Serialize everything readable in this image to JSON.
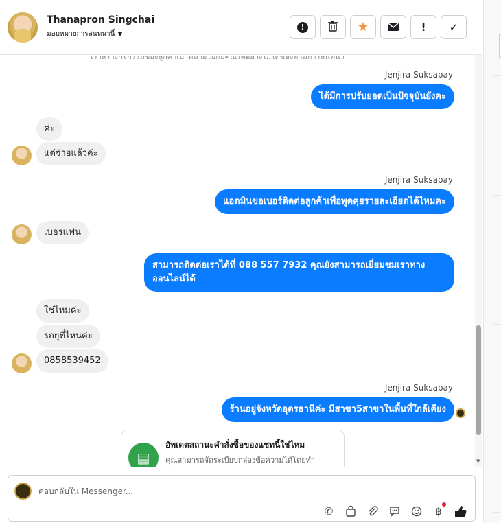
{
  "header": {
    "name": "Thanapron Singchai",
    "assign_label": "มอบหมายการสนทนานี้",
    "toolbar": [
      {
        "icon": "alert-circle-icon",
        "glyph": "❗"
      },
      {
        "icon": "trash-icon",
        "glyph": "🗑"
      },
      {
        "icon": "star-icon",
        "glyph": "★"
      },
      {
        "icon": "mail-icon",
        "glyph": "✉"
      },
      {
        "icon": "exclamation-icon",
        "glyph": "!"
      },
      {
        "icon": "check-icon",
        "glyph": "✓"
      }
    ]
  },
  "chat": {
    "clipped_top": "เราสร้างกิจกรรมของลูกค้าเป้าหมายไปกับคุณได้อย่างไมได้ของตามการสนทนา",
    "messages": [
      {
        "type": "sender",
        "text": "Jenjira Suksabay"
      },
      {
        "type": "out",
        "text": "ได้มีการปรับยอดเป็นปัจจุบันยังคะ"
      },
      {
        "type": "in",
        "text": "ค่ะ"
      },
      {
        "type": "in",
        "text": "แต่จ่ายแล้วค่ะ"
      },
      {
        "type": "sender",
        "text": "Jenjira Suksabay"
      },
      {
        "type": "out",
        "text": "แอดมินขอเบอร์ติดต่อลูกค้าเพื่อพูดคุยรายละเอียดได้ไหมคะ"
      },
      {
        "type": "in",
        "text": "เบอรแฟน"
      },
      {
        "type": "out",
        "text": "สามารถติดต่อเราได้ที่ 088 557 7932 คุณยังสามารถเยี่ยมชมเราทางออนไลน์ได้"
      },
      {
        "type": "in",
        "text": "ใช่ไหมค่ะ"
      },
      {
        "type": "in",
        "text": "รถยุที่ไหนค่ะ"
      },
      {
        "type": "in",
        "text": "0858539452"
      },
      {
        "type": "sender",
        "text": "Jenjira Suksabay"
      },
      {
        "type": "out",
        "text": "ร้านอยู่จังหวัดอุดรธานีค่ะ มีสาขา5สาขาในพื้นที่ใกล้เคียง"
      }
    ],
    "card": {
      "title": "อัพเดตสถานะคำสั่งซื้อของแชทนี้ใช่ไหม",
      "desc": "คุณสามารถจัดระเบียบกล่องข้อความได้โดยทำ"
    }
  },
  "composer": {
    "placeholder": "ตอบกลับใน Messenger...",
    "tools": [
      "phone-plus-icon",
      "shopping-bag-icon",
      "paperclip-icon",
      "chat-bubble-icon",
      "emoji-icon",
      "baht-icon",
      "thumbs-up-icon"
    ]
  }
}
